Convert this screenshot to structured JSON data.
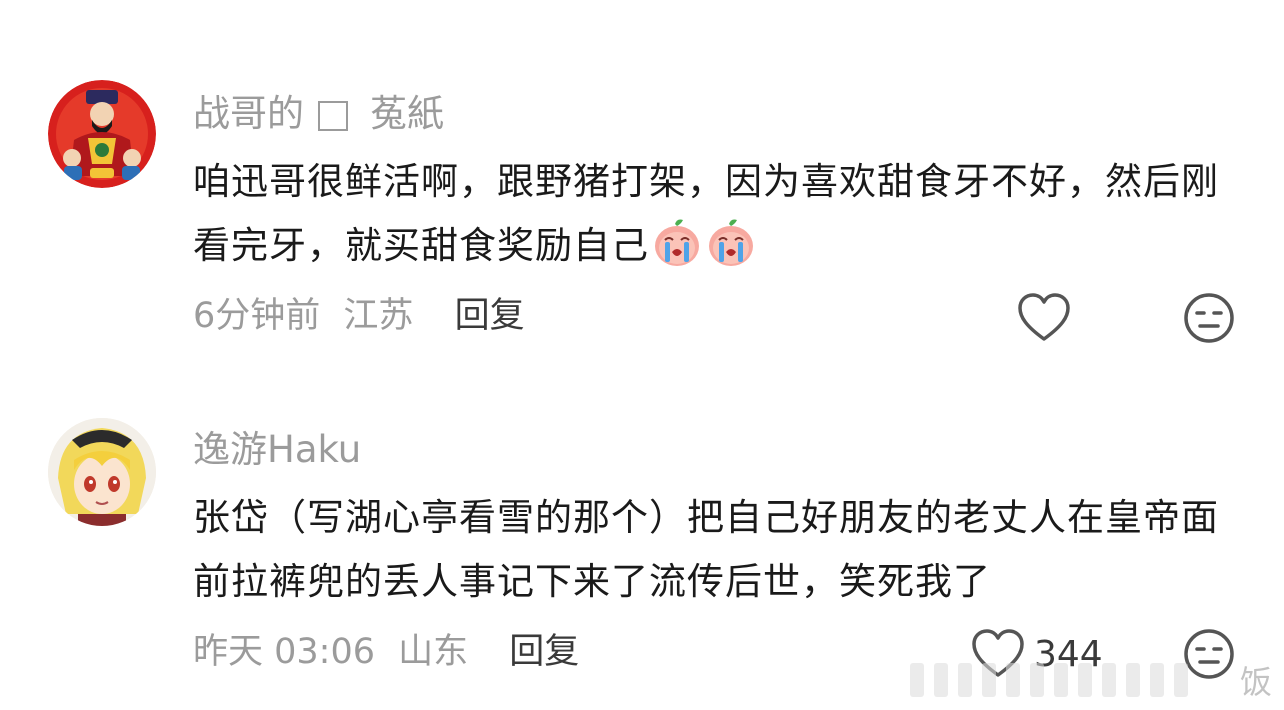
{
  "comments": [
    {
      "username_part1": "战哥的",
      "username_part2": "菟紙",
      "text": "咱迅哥很鲜活啊，跟野猪打架，因为喜欢甜食牙不好，然后刚看完牙，就买甜食奖励自己",
      "time": "6分钟前",
      "location": "江苏",
      "reply_label": "回复",
      "like_count": "",
      "emojis": [
        "crying-face-emoji",
        "crying-face-emoji"
      ]
    },
    {
      "username_part1": "逸游Haku",
      "text": "张岱（写湖心亭看雪的那个）把自己好朋友的老丈人在皇帝面前拉裤兜的丢人事记下来了流传后世，笑死我了",
      "time": "昨天 03:06",
      "location": "山东",
      "reply_label": "回复",
      "like_count": "344"
    }
  ],
  "watermark": {
    "text": "饭"
  },
  "icons": {
    "like": "heart-outline-icon",
    "dislike": "meh-face-icon"
  },
  "colors": {
    "secondary_text": "#9b9b9b",
    "primary_text": "#1a1a1a",
    "reply_text": "#3a3a3a",
    "avatar1_bg": "#d7201d"
  }
}
